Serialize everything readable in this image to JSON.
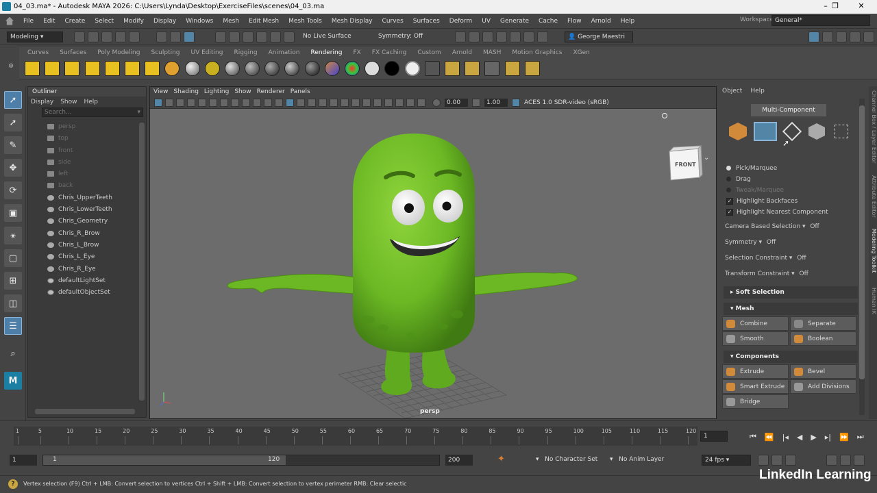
{
  "titlebar": {
    "title": "04_03.ma* - Autodesk MAYA 2026: C:\\Users\\Lynda\\Desktop\\ExerciseFiles\\scenes\\04_03.ma",
    "minimize": "–",
    "maximize": "❐",
    "close": "✕"
  },
  "menubar": {
    "items": [
      "File",
      "Edit",
      "Create",
      "Select",
      "Modify",
      "Display",
      "Windows",
      "Mesh",
      "Edit Mesh",
      "Mesh Tools",
      "Mesh Display",
      "Curves",
      "Surfaces",
      "Deform",
      "UV",
      "Generate",
      "Cache",
      "Flow",
      "Arnold",
      "Help"
    ],
    "workspace_label": "Workspace:",
    "workspace_value": "General*"
  },
  "statusline": {
    "mode": "Modeling",
    "live_surface": "No Live Surface",
    "symmetry": "Symmetry: Off",
    "user": "George Maestri"
  },
  "shelf": {
    "tabs": [
      "Curves",
      "Surfaces",
      "Poly Modeling",
      "Sculpting",
      "UV Editing",
      "Rigging",
      "Animation",
      "Rendering",
      "FX",
      "FX Caching",
      "Custom",
      "Arnold",
      "MASH",
      "Motion Graphics",
      "XGen"
    ],
    "active_tab": "Rendering"
  },
  "outliner": {
    "title": "Outliner",
    "menu": [
      "Display",
      "Show",
      "Help"
    ],
    "search_placeholder": "Search...",
    "items": [
      {
        "label": "persp",
        "type": "camera"
      },
      {
        "label": "top",
        "type": "camera"
      },
      {
        "label": "front",
        "type": "camera"
      },
      {
        "label": "side",
        "type": "camera"
      },
      {
        "label": "left",
        "type": "camera"
      },
      {
        "label": "back",
        "type": "camera"
      },
      {
        "label": "Chris_UpperTeeth",
        "type": "mesh"
      },
      {
        "label": "Chris_LowerTeeth",
        "type": "mesh"
      },
      {
        "label": "Chris_Geometry",
        "type": "mesh"
      },
      {
        "label": "Chris_R_Brow",
        "type": "mesh"
      },
      {
        "label": "Chris_L_Brow",
        "type": "mesh"
      },
      {
        "label": "Chris_L_Eye",
        "type": "mesh"
      },
      {
        "label": "Chris_R_Eye",
        "type": "mesh"
      },
      {
        "label": "defaultLightSet",
        "type": "set"
      },
      {
        "label": "defaultObjectSet",
        "type": "set"
      }
    ]
  },
  "viewport": {
    "menu": [
      "View",
      "Shading",
      "Lighting",
      "Show",
      "Renderer",
      "Panels"
    ],
    "exposure": "0.00",
    "gamma": "1.00",
    "colorspace": "ACES 1.0 SDR-video (sRGB)",
    "camera_label": "persp",
    "viewcube_label": "FRONT"
  },
  "toolkit": {
    "menu": [
      "Object",
      "Help"
    ],
    "mode_button": "Multi-Component",
    "pick_options": [
      {
        "label": "Pick/Marquee",
        "on": true
      },
      {
        "label": "Drag",
        "on": false
      },
      {
        "label": "Tweak/Marquee",
        "on": false
      }
    ],
    "checks": [
      "Highlight Backfaces",
      "Highlight Nearest Component"
    ],
    "settings": [
      {
        "label": "Camera Based Selection",
        "value": "Off"
      },
      {
        "label": "Symmetry",
        "value": "Off"
      },
      {
        "label": "Selection Constraint",
        "value": "Off"
      },
      {
        "label": "Transform Constraint",
        "value": "Off"
      }
    ],
    "soft_selection": "Soft Selection",
    "mesh_header": "Mesh",
    "mesh_buttons": [
      "Combine",
      "Separate",
      "Smooth",
      "Boolean"
    ],
    "components_header": "Components",
    "component_buttons": [
      "Extrude",
      "Bevel",
      "Smart Extrude",
      "Add Divisions",
      "Bridge"
    ]
  },
  "sidetabs": [
    "Channel Box / Layer Editor",
    "Attribute Editor",
    "Modeling Toolkit",
    "Human IK"
  ],
  "timeline": {
    "ticks": [
      "1",
      "5",
      "10",
      "15",
      "20",
      "25",
      "30",
      "35",
      "40",
      "45",
      "50",
      "55",
      "60",
      "65",
      "70",
      "75",
      "80",
      "85",
      "90",
      "95",
      "100",
      "105",
      "110",
      "115",
      "120"
    ],
    "current_frame": "1"
  },
  "range": {
    "start": "1",
    "inner_start": "1",
    "inner_end": "120",
    "end": "200",
    "character_set": "No Character Set",
    "anim_layer": "No Anim Layer",
    "fps": "24 fps"
  },
  "helpline": {
    "text": "Vertex selection (F9) Ctrl + LMB: Convert selection to vertices Ctrl + Shift + LMB: Convert selection to vertex perimeter RMB: Clear selectic"
  },
  "watermark": "LinkedIn Learning",
  "colors": {
    "character_green": "#6bb824",
    "selection_blue": "#5285a6"
  }
}
